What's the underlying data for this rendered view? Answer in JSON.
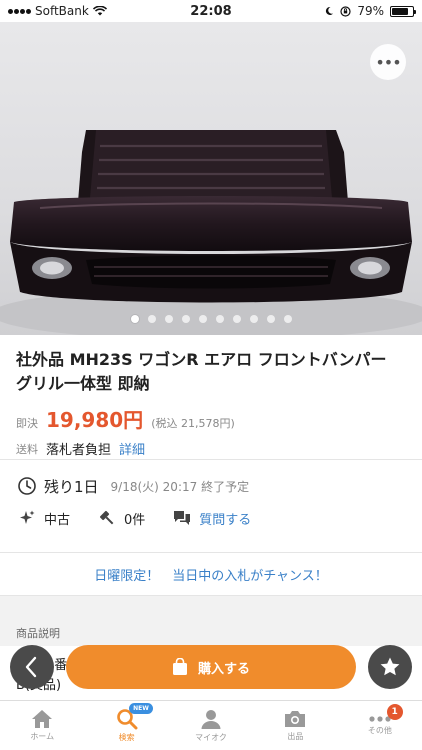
{
  "status": {
    "carrier": "SoftBank",
    "time": "22:08",
    "battery": "79%",
    "battery_level": 0.79
  },
  "gallery": {
    "image_count": 10,
    "active_index": 0
  },
  "item": {
    "title": "社外品 MH23S ワゴンR エアロ フロントバンパー グリル一体型 即納",
    "price_label": "即決",
    "price": "19,980円",
    "tax_note": "(税込 21,578円)",
    "shipping_label": "送料",
    "shipping_value": "落札者負担",
    "shipping_detail": "詳細"
  },
  "auction": {
    "remaining": "残り1日",
    "end_time": "9/18(火) 20:17 終了予定",
    "condition": "中古",
    "bids": "0件",
    "ask_question": "質問する"
  },
  "banner": {
    "text": "日曜限定！　当日中の入札がチャンス！"
  },
  "description": {
    "header": "商品説明",
    "line1": "■商品番号",
    "line2": "B(美品)"
  },
  "actions": {
    "buy": "購入する"
  },
  "tabbar": {
    "items": [
      {
        "label": "ホーム"
      },
      {
        "label": "検索",
        "badge": "NEW"
      },
      {
        "label": "マイオク"
      },
      {
        "label": "出品"
      },
      {
        "label": "その他",
        "badge": "1"
      }
    ]
  },
  "colors": {
    "accent": "#f08c2c",
    "price": "#e4572e",
    "link": "#3a80c8"
  }
}
